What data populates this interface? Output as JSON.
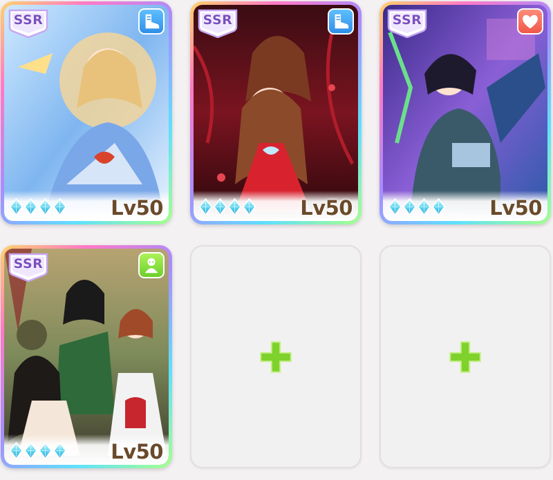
{
  "support_cards": [
    {
      "rarity": "SSR",
      "type_icon": "speed-shoe-icon",
      "level": "Lv50",
      "limit_break": 4,
      "accent": "#2f8fe8"
    },
    {
      "rarity": "SSR",
      "type_icon": "speed-shoe-icon",
      "level": "Lv50",
      "limit_break": 4,
      "accent": "#2f8fe8"
    },
    {
      "rarity": "SSR",
      "type_icon": "heart-icon",
      "level": "Lv50",
      "limit_break": 4,
      "accent": "#f0584b"
    },
    {
      "rarity": "SSR",
      "type_icon": "group-icon",
      "level": "Lv50",
      "limit_break": 4,
      "accent": "#6ccf2a"
    }
  ],
  "empty_slots": [
    {
      "icon": "plus-icon",
      "color": "#7fd12c"
    },
    {
      "icon": "plus-icon",
      "color": "#7fd12c"
    }
  ]
}
